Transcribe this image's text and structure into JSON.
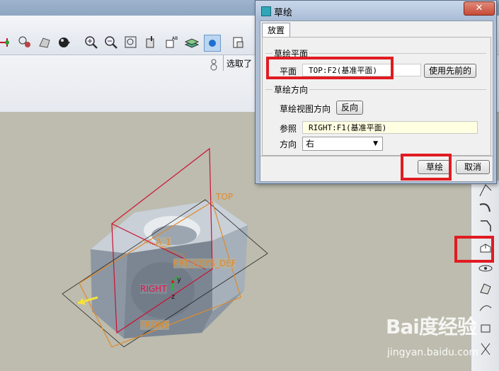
{
  "dialog": {
    "title": "草绘",
    "close_symbol": "✕",
    "tab_label": "放置",
    "sketch_plane_group": "草绘平面",
    "plane_label": "平面",
    "plane_value": "TOP:F2(基准平面)",
    "use_previous_button": "使用先前的",
    "sketch_direction_group": "草绘方向",
    "view_direction_label": "草绘视图方向",
    "flip_button": "反向",
    "reference_label": "参照",
    "reference_value": "RIGHT:F1(基准平面)",
    "orientation_label": "方向",
    "orientation_value": "右",
    "sketch_button": "草绘",
    "cancel_button": "取消"
  },
  "selectbar": {
    "selected_text": "选取了"
  },
  "viewport": {
    "labels": {
      "top": "TOP",
      "a1": "A_1",
      "csys": "PRT_CSYS_DEF",
      "right": "RIGHT",
      "front": "FRONT",
      "axis_y": "y",
      "axis_z": "z"
    }
  },
  "icons": {
    "toolbar": [
      "sketch-icon",
      "datum-display-icon",
      "shading-icon",
      "sphere-icon",
      "zoom-in-icon",
      "zoom-out-icon",
      "refit-icon",
      "reorient-icon",
      "annotation-icon",
      "layers-icon",
      "color-icon",
      "saved-views-icon"
    ],
    "right_toolbar": [
      "revolve-icon",
      "sweep-icon",
      "chamfer-icon",
      "draft-icon",
      "pattern-icon",
      "mirror-icon",
      "rib-icon",
      "shell-icon"
    ]
  },
  "watermark": {
    "logo": "Bai度经验",
    "site": "jingyan.baidu.com"
  },
  "colors": {
    "highlight_box": "#e11b22",
    "datum_orange": "#e08a2b",
    "datum_red": "#cc1133"
  }
}
